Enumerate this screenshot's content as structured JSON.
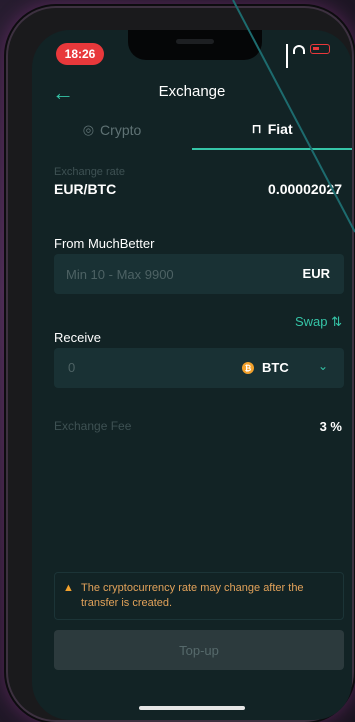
{
  "status_bar": {
    "time": "18:26"
  },
  "header": {
    "title": "Exchange"
  },
  "tabs": [
    {
      "label": "Crypto",
      "icon": "crypto-icon",
      "active": false
    },
    {
      "label": "Fiat",
      "icon": "fiat-icon",
      "active": true
    }
  ],
  "exchange_rate": {
    "label": "Exchange rate",
    "pair": "EUR/BTC",
    "value": "0.00002027"
  },
  "from": {
    "label": "From MuchBetter",
    "placeholder": "Min 10 - Max 9900",
    "currency": "EUR"
  },
  "swap_label": "Swap",
  "receive": {
    "label": "Receive",
    "value": "0",
    "currency": "BTC",
    "currency_icon": "bitcoin-icon"
  },
  "fee": {
    "label": "Exchange Fee",
    "value": "3 %"
  },
  "warning": {
    "icon": "warning-icon",
    "text": "The cryptocurrency rate may change after the transfer is created."
  },
  "topup_label": "Top-up",
  "colors": {
    "accent": "#35c4a7",
    "background": "#122325",
    "field": "#193134",
    "warning": "#f2a12c",
    "alert": "#e8383b"
  }
}
